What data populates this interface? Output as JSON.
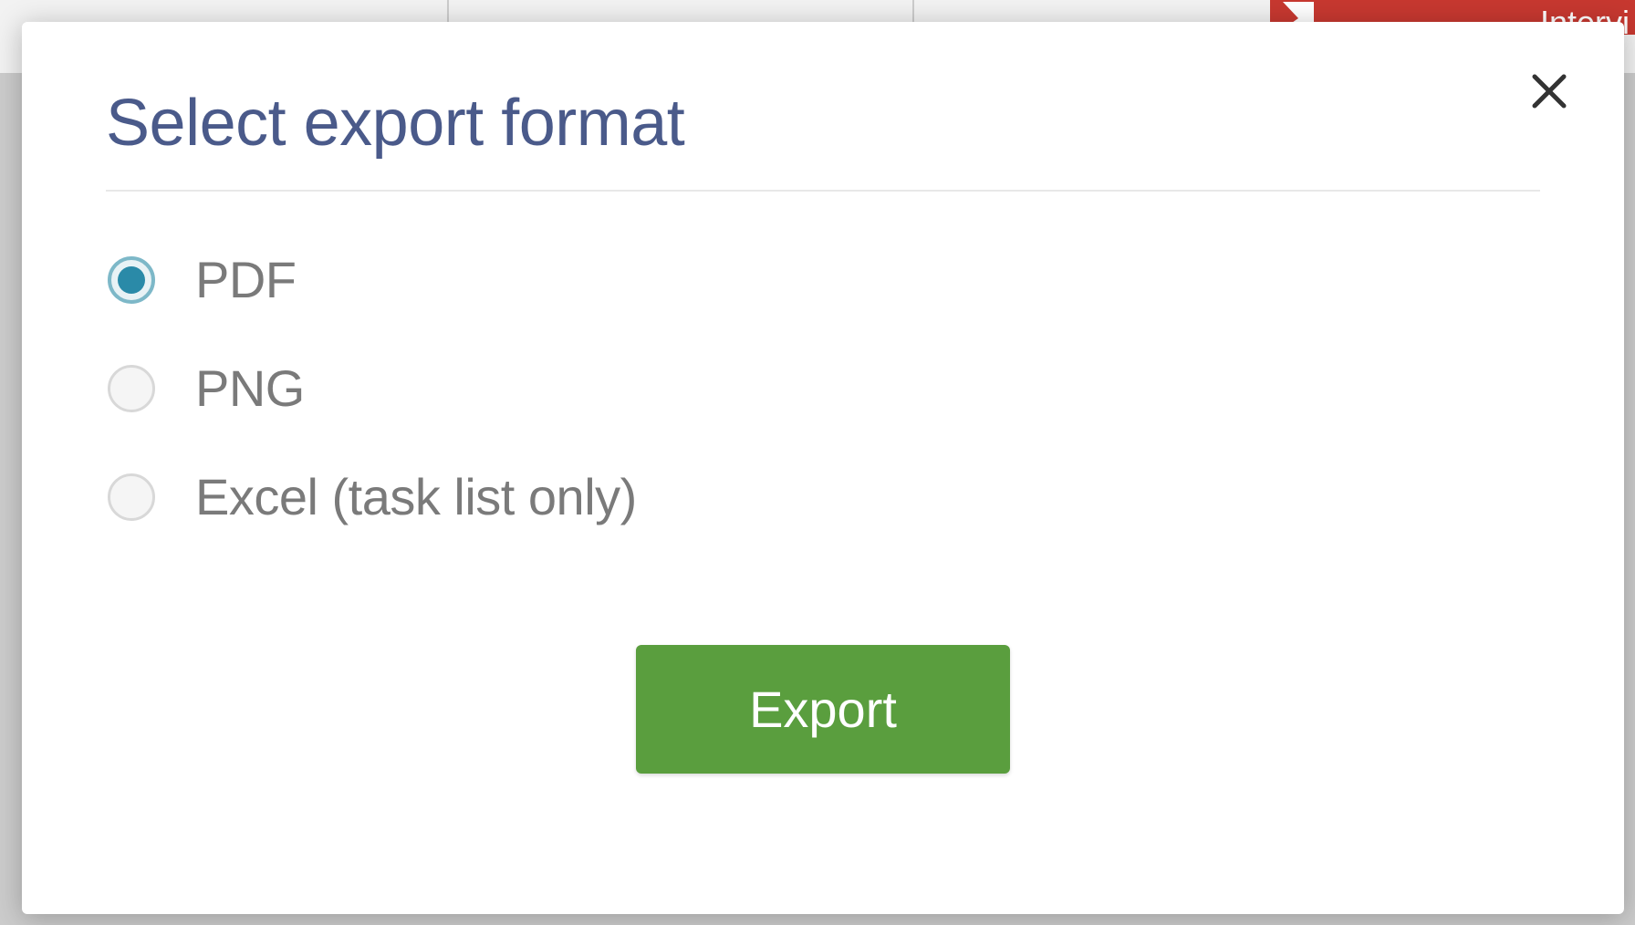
{
  "background": {
    "partial_text": "Intervi"
  },
  "modal": {
    "title": "Select export format",
    "options": [
      {
        "label": "PDF",
        "selected": true
      },
      {
        "label": "PNG",
        "selected": false
      },
      {
        "label": "Excel (task list only)",
        "selected": false
      }
    ],
    "export_button_label": "Export"
  },
  "colors": {
    "title": "#4a5a8a",
    "button_bg": "#5a9e3e",
    "radio_selected": "#2a8aa8"
  }
}
